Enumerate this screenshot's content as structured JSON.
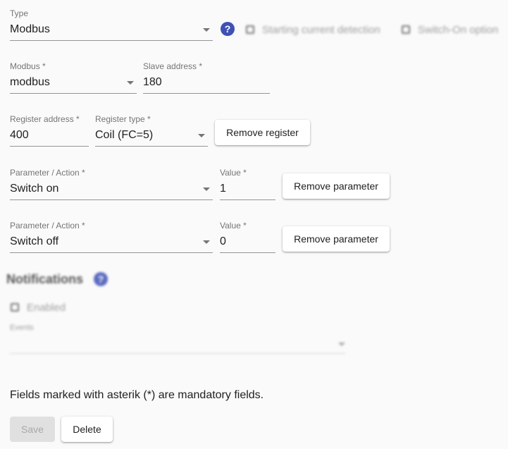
{
  "type_field": {
    "label": "Type",
    "value": "Modbus"
  },
  "help_icon_char": "?",
  "options": {
    "starting_current": "Starting current detection",
    "switch_on": "Switch-On option"
  },
  "modbus": {
    "modbus_field": {
      "label": "Modbus *",
      "value": "modbus"
    },
    "slave_address": {
      "label": "Slave address *",
      "value": "180"
    }
  },
  "register": {
    "address": {
      "label": "Register address *",
      "value": "400"
    },
    "type": {
      "label": "Register type *",
      "value": "Coil (FC=5)"
    },
    "remove_label": "Remove register"
  },
  "parameters": [
    {
      "label": "Parameter / Action *",
      "value": "Switch on",
      "value_label": "Value *",
      "value_value": "1",
      "remove_label": "Remove parameter"
    },
    {
      "label": "Parameter / Action *",
      "value": "Switch off",
      "value_label": "Value *",
      "value_value": "0",
      "remove_label": "Remove parameter"
    }
  ],
  "notifications": {
    "heading": "Notifications",
    "enabled_label": "Enabled",
    "events_label": "Events"
  },
  "footer_note": "Fields marked with asterik (*) are mandatory fields.",
  "actions": {
    "save": "Save",
    "delete": "Delete"
  },
  "colors": {
    "accent": "#3f51b5",
    "background": "#fafafa"
  }
}
